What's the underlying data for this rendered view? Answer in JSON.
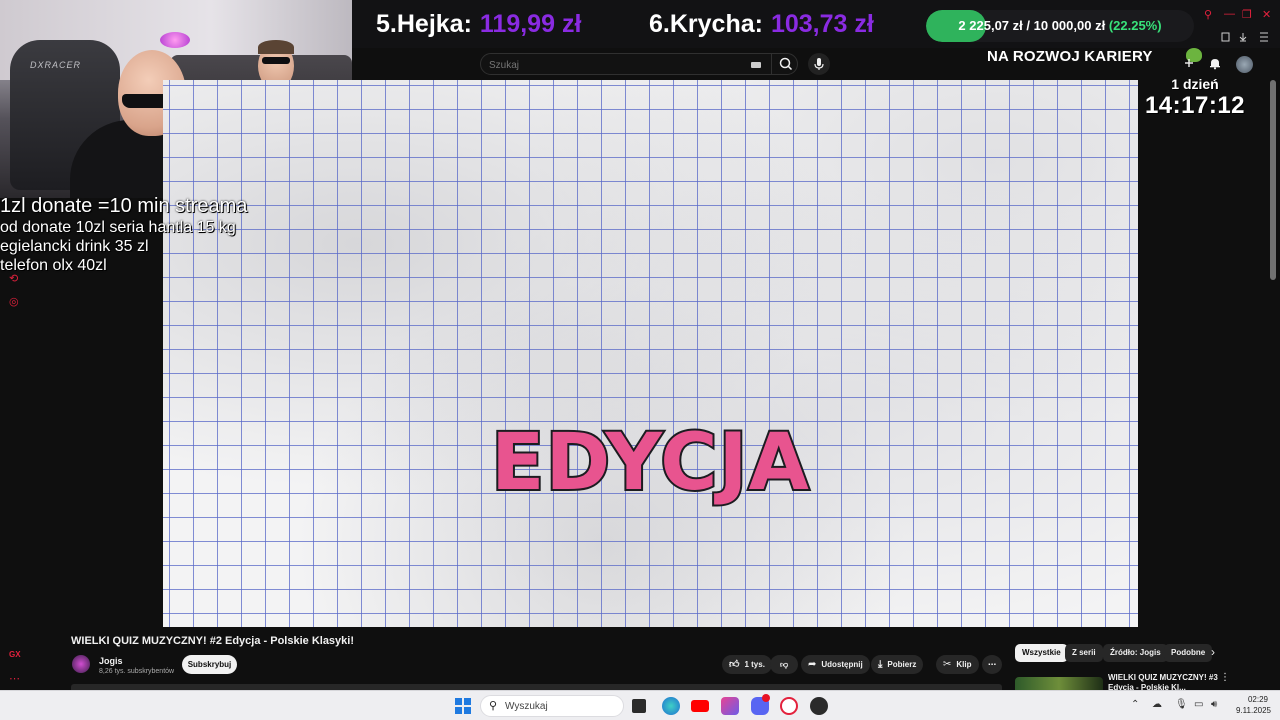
{
  "donations": {
    "entries": [
      {
        "rank": "5.",
        "name": "Hejka:",
        "amount": "119,99 zł"
      },
      {
        "rank": "6.",
        "name": "Krycha:",
        "amount": "103,73 zł"
      }
    ],
    "goal": {
      "current": "2 225,07 zł",
      "separator": "/",
      "target": "10 000,00 zł",
      "percent": "(22.25%)",
      "fraction": 0.2225,
      "fill_color": "#2fb35c"
    },
    "amount_color": "#8a2be2"
  },
  "header": {
    "label": "NA ROZWOJ KARIERY",
    "search_placeholder": "Szukaj"
  },
  "overlay": {
    "lines": [
      "1zl donate =10 min streama",
      "od donate 10zl seria hantla 15 kg",
      "egielancki drink 35 zl",
      "telefon olx 40zl"
    ]
  },
  "webcam": {
    "chair_brand": "DXRACER"
  },
  "timer": {
    "days": "1 dzień",
    "time": "14:17:12"
  },
  "video": {
    "frame_text": "EDYCJA",
    "frame_text_color": "#e8548f",
    "title": "WIELKI QUIZ MUZYCZNY! #2 Edycja - Polskie Klasyki!",
    "channel": "Jogis",
    "subscribers": "8,26 tys. subskrybentów",
    "subscribe_label": "Subskrybuj",
    "actions": {
      "likes": "1 tys.",
      "share": "Udostępnij",
      "download": "Pobierz",
      "clip": "Klip"
    }
  },
  "chips": [
    "Wszystkie",
    "Z serii",
    "Źródło: Jogis",
    "Podobne"
  ],
  "recommendation": {
    "title_line1": "WIELKI QUIZ MUZYCZNY! #3",
    "title_line2": "Edycja - Polskie Kl..."
  },
  "taskbar": {
    "search_label": "Wyszukaj",
    "time": "02:29",
    "date": "9.11.2025"
  },
  "colors": {
    "accent_red": "#e3213d",
    "youtube_bg": "#0f0f0f",
    "goal_green": "#38e27a"
  }
}
